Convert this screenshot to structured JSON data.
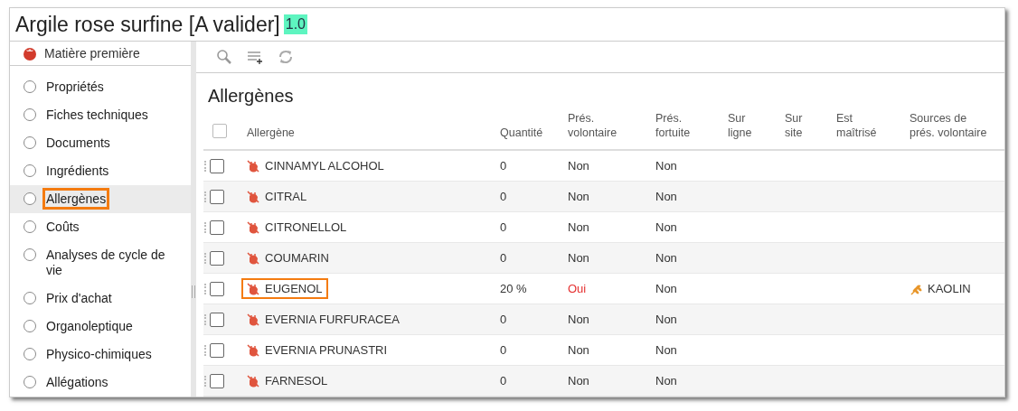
{
  "window": {
    "title": "Argile rose surfine [A valider]",
    "version": "1.0"
  },
  "sidebar": {
    "header": "Matière première",
    "items": [
      {
        "label": "Propriétés",
        "selected": false,
        "highlighted": false
      },
      {
        "label": "Fiches techniques",
        "selected": false,
        "highlighted": false
      },
      {
        "label": "Documents",
        "selected": false,
        "highlighted": false
      },
      {
        "label": "Ingrédients",
        "selected": false,
        "highlighted": false
      },
      {
        "label": "Allergènes",
        "selected": true,
        "highlighted": true
      },
      {
        "label": "Coûts",
        "selected": false,
        "highlighted": false
      },
      {
        "label": "Analyses de cycle de vie",
        "selected": false,
        "highlighted": false
      },
      {
        "label": "Prix d'achat",
        "selected": false,
        "highlighted": false
      },
      {
        "label": "Organoleptique",
        "selected": false,
        "highlighted": false
      },
      {
        "label": "Physico-chimiques",
        "selected": false,
        "highlighted": false
      },
      {
        "label": "Allégations",
        "selected": false,
        "highlighted": false
      }
    ]
  },
  "section_title": "Allergènes",
  "table": {
    "select_all": {
      "checked": false
    },
    "columns": [
      "Allergène",
      "Quantité",
      "Prés. volontaire",
      "Prés. fortuite",
      "Sur ligne",
      "Sur site",
      "Est maîtrisé",
      "Sources de prés. volontaire"
    ],
    "rows": [
      {
        "checked": false,
        "name": "CINNAMYL ALCOHOL",
        "highlighted": false,
        "quantity": "0",
        "voluntary": "Non",
        "voluntary_alert": false,
        "fortuitous": "Non",
        "sources": []
      },
      {
        "checked": false,
        "name": "CITRAL",
        "highlighted": false,
        "quantity": "0",
        "voluntary": "Non",
        "voluntary_alert": false,
        "fortuitous": "Non",
        "sources": []
      },
      {
        "checked": false,
        "name": "CITRONELLOL",
        "highlighted": false,
        "quantity": "0",
        "voluntary": "Non",
        "voluntary_alert": false,
        "fortuitous": "Non",
        "sources": []
      },
      {
        "checked": false,
        "name": "COUMARIN",
        "highlighted": false,
        "quantity": "0",
        "voluntary": "Non",
        "voluntary_alert": false,
        "fortuitous": "Non",
        "sources": []
      },
      {
        "checked": false,
        "name": "EUGENOL",
        "highlighted": true,
        "quantity": "20 %",
        "voluntary": "Oui",
        "voluntary_alert": true,
        "fortuitous": "Non",
        "sources": [
          "KAOLIN"
        ]
      },
      {
        "checked": false,
        "name": "EVERNIA FURFURACEA",
        "highlighted": false,
        "quantity": "0",
        "voluntary": "Non",
        "voluntary_alert": false,
        "fortuitous": "Non",
        "sources": []
      },
      {
        "checked": false,
        "name": "EVERNIA PRUNASTRI",
        "highlighted": false,
        "quantity": "0",
        "voluntary": "Non",
        "voluntary_alert": false,
        "fortuitous": "Non",
        "sources": []
      },
      {
        "checked": false,
        "name": "FARNESOL",
        "highlighted": false,
        "quantity": "0",
        "voluntary": "Non",
        "voluntary_alert": false,
        "fortuitous": "Non",
        "sources": []
      }
    ]
  }
}
